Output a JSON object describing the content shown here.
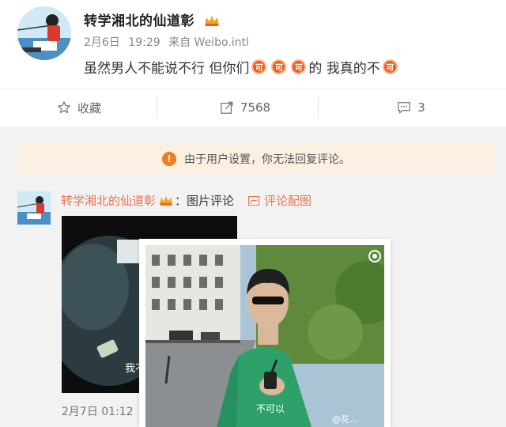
{
  "post": {
    "author": "转学湘北的仙道彰",
    "date": "2月6日",
    "time": "19:29",
    "source": "来自 Weibo.intl",
    "text_parts": [
      "虽然男人不能说不行 但你们",
      "",
      "",
      "",
      "的 我真的不",
      ""
    ],
    "emoji_label": "可",
    "actions": {
      "favorite": "收藏",
      "repost_count": "7568",
      "comment_count": "3"
    }
  },
  "notice": "由于用户设置，你无法回复评论。",
  "comment": {
    "author": "转学湘北的仙道彰",
    "colon": "：",
    "type_label": "图片评论",
    "image_link": "评论配图",
    "thumb_caption": "我不",
    "photo_subtitle": "不可以",
    "photo_watermark": "@花…",
    "date": "2月7日 01:12"
  },
  "colors": {
    "accent": "#eb7350",
    "notice_bg": "#fbf0e2",
    "emoji": "#f25c1f"
  },
  "icons": [
    "crown-icon",
    "star-icon",
    "repost-icon",
    "comment-icon",
    "warning-icon",
    "picture-icon",
    "camera-icon"
  ]
}
